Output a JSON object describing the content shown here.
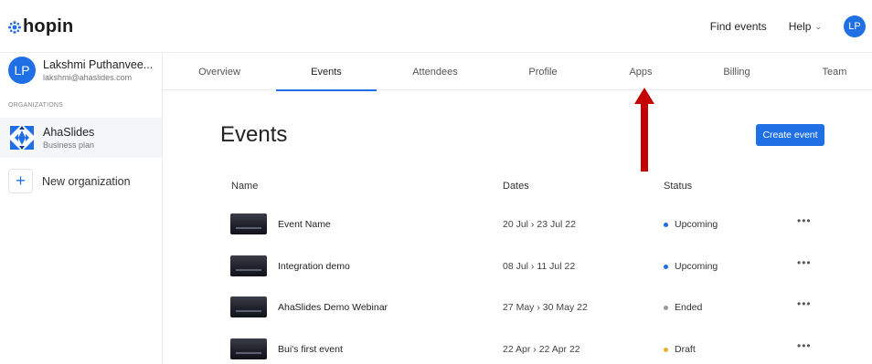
{
  "brand": {
    "name": "hopin",
    "color": "#1f6fe5"
  },
  "topnav": {
    "find_events": "Find events",
    "help": "Help",
    "avatar_initials": "LP"
  },
  "user": {
    "initials": "LP",
    "name": "Lakshmi Puthanvee...",
    "email": "lakshmi@ahaslides.com"
  },
  "organizations": {
    "heading": "ORGANIZATIONS",
    "items": [
      {
        "name": "AhaSlides",
        "plan": "Business plan"
      }
    ],
    "new_label": "New organization"
  },
  "tabs": [
    {
      "label": "Overview"
    },
    {
      "label": "Events"
    },
    {
      "label": "Attendees"
    },
    {
      "label": "Profile"
    },
    {
      "label": "Apps"
    },
    {
      "label": "Billing"
    },
    {
      "label": "Team"
    }
  ],
  "active_tab": "Events",
  "page": {
    "title": "Events",
    "create_button": "Create event"
  },
  "table": {
    "headers": {
      "name": "Name",
      "dates": "Dates",
      "status": "Status"
    },
    "rows": [
      {
        "name": "Event Name",
        "dates": "20 Jul › 23 Jul 22",
        "status": "Upcoming",
        "status_color": "#1f6fe5",
        "more": "•••"
      },
      {
        "name": "Integration demo",
        "dates": "08 Jul › 11 Jul 22",
        "status": "Upcoming",
        "status_color": "#1f6fe5",
        "more": "•••"
      },
      {
        "name": "AhaSlides Demo Webinar",
        "dates": "27 May › 30 May 22",
        "status": "Ended",
        "status_color": "#9a9a9a",
        "more": "•••"
      },
      {
        "name": "Bui's first event",
        "dates": "22 Apr › 22 Apr 22",
        "status": "Draft",
        "status_color": "#e8b12a",
        "more": "•••"
      }
    ]
  },
  "annotation": {
    "arrow_color": "#c40000"
  }
}
